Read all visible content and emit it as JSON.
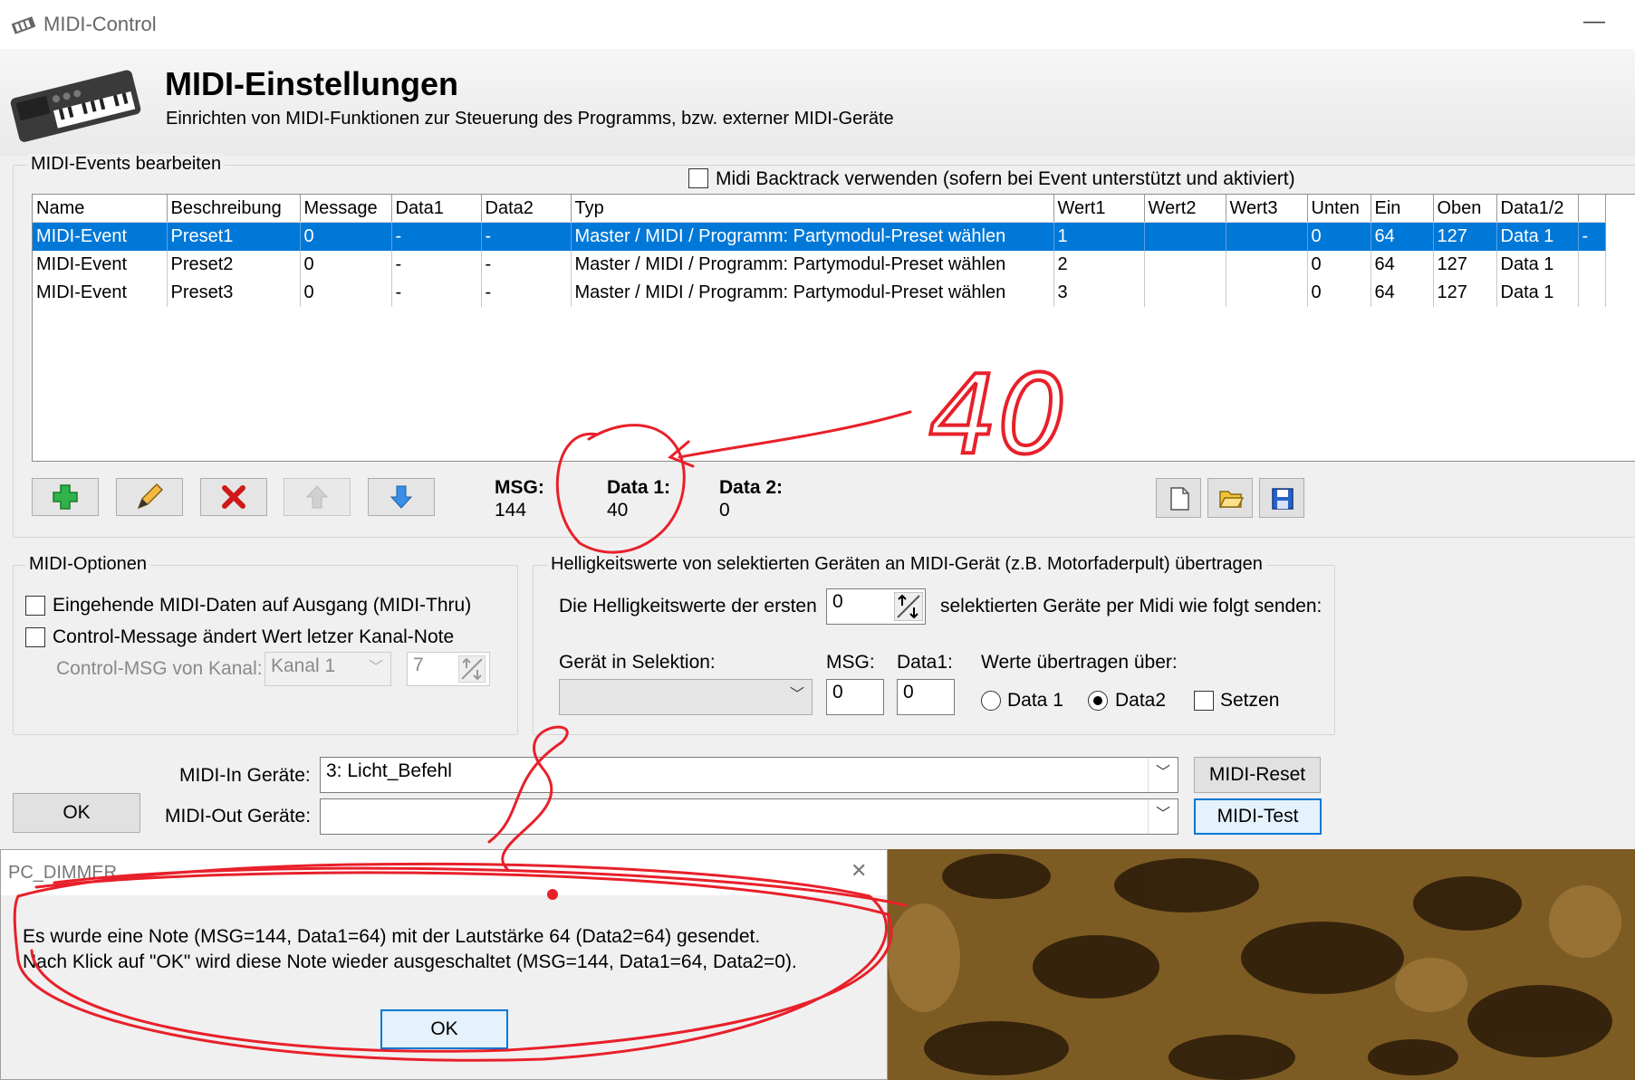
{
  "window": {
    "title": "MIDI-Control",
    "minimize": "—"
  },
  "header": {
    "title": "MIDI-Einstellungen",
    "subtitle": "Einrichten von MIDI-Funktionen zur Steuerung des Programms, bzw. externer MIDI-Geräte"
  },
  "events": {
    "group_label": "MIDI-Events bearbeiten",
    "backtrack_label": "Midi Backtrack verwenden (sofern bei Event unterstützt und aktiviert)",
    "columns": [
      "Name",
      "Beschreibung",
      "Message",
      "Data1",
      "Data2",
      "Typ",
      "Wert1",
      "Wert2",
      "Wert3",
      "Unten",
      "Ein",
      "Oben",
      "Data1/2",
      ""
    ],
    "rows": [
      [
        "MIDI-Event",
        "Preset1",
        "0",
        "-",
        "-",
        "Master / MIDI / Programm: Partymodul-Preset wählen",
        "1",
        "",
        "",
        "0",
        "64",
        "127",
        "Data 1",
        "-"
      ],
      [
        "MIDI-Event",
        "Preset2",
        "0",
        "-",
        "-",
        "Master / MIDI / Programm: Partymodul-Preset wählen",
        "2",
        "",
        "",
        "0",
        "64",
        "127",
        "Data 1",
        ""
      ],
      [
        "MIDI-Event",
        "Preset3",
        "0",
        "-",
        "-",
        "Master / MIDI / Programm: Partymodul-Preset wählen",
        "3",
        "",
        "",
        "0",
        "64",
        "127",
        "Data 1",
        ""
      ]
    ],
    "msg_label": "MSG:",
    "msg_value": "144",
    "data1_label": "Data 1:",
    "data1_value": "40",
    "data2_label": "Data 2:",
    "data2_value": "0"
  },
  "options": {
    "group_label": "MIDI-Optionen",
    "thru_label": "Eingehende MIDI-Daten auf Ausgang (MIDI-Thru)",
    "control_label": "Control-Message ändert Wert letzer Kanal-Note",
    "channel_label": "Control-MSG von Kanal:",
    "channel_value": "Kanal 1",
    "channel_num": "7"
  },
  "brightness": {
    "group_label": "Helligkeitswerte von selektierten Geräten an MIDI-Gerät (z.B. Motorfaderpult) übertragen",
    "first_label": "Die Helligkeitswerte der ersten",
    "first_value": "0",
    "first_suffix": "selektierten Geräte per Midi wie folgt senden:",
    "device_label": "Gerät in Selektion:",
    "msg_label": "MSG:",
    "msg_value": "0",
    "data1_label": "Data1:",
    "data1_value": "0",
    "transfer_label": "Werte übertragen über:",
    "radio1": "Data 1",
    "radio2": "Data2",
    "set_label": "Setzen"
  },
  "devices": {
    "in_label": "MIDI-In Geräte:",
    "in_value": "3: Licht_Befehl",
    "out_label": "MIDI-Out Geräte:",
    "out_value": "",
    "reset_btn": "MIDI-Reset",
    "test_btn": "MIDI-Test",
    "ok_btn": "OK"
  },
  "dialog": {
    "title": "PC_DIMMER",
    "close": "✕",
    "line1": "Es wurde eine Note (MSG=144, Data1=64) mit der Lautstärke 64 (Data2=64) gesendet.",
    "line2": "Nach Klick auf \"OK\" wird diese Note wieder ausgeschaltet (MSG=144, Data1=64, Data2=0).",
    "ok": "OK"
  },
  "annotation": {
    "text": "40",
    "color": "#e8202a"
  },
  "colors": {
    "selection": "#0078d7",
    "accent_border": "#0078d7"
  }
}
